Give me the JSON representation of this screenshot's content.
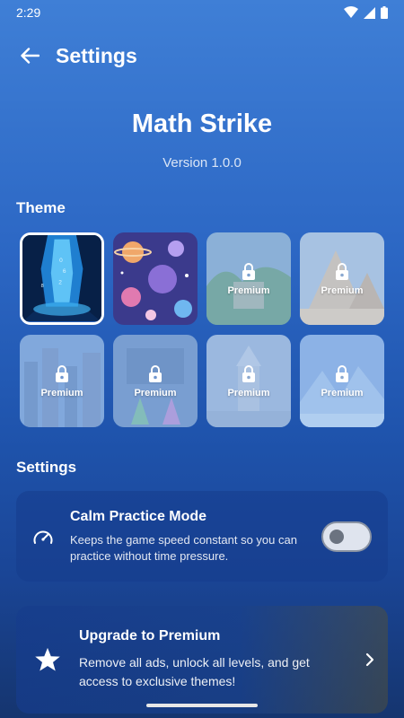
{
  "status_bar": {
    "time": "2:29"
  },
  "header": {
    "title": "Settings",
    "back_icon": "arrow-left-icon"
  },
  "app": {
    "name": "Math Strike",
    "version": "Version 1.0.0"
  },
  "theme_section": {
    "label": "Theme",
    "tiles": [
      {
        "name": "crystal-cave",
        "locked": false,
        "selected": true,
        "premium_label": ""
      },
      {
        "name": "space-planets",
        "locked": false,
        "selected": false,
        "premium_label": ""
      },
      {
        "name": "jungle-temple",
        "locked": true,
        "selected": false,
        "premium_label": "Premium"
      },
      {
        "name": "desert-pyramids",
        "locked": true,
        "selected": false,
        "premium_label": "Premium"
      },
      {
        "name": "city-skyline",
        "locked": true,
        "selected": false,
        "premium_label": "Premium"
      },
      {
        "name": "science-lab",
        "locked": true,
        "selected": false,
        "premium_label": "Premium"
      },
      {
        "name": "fantasy-castle",
        "locked": true,
        "selected": false,
        "premium_label": "Premium"
      },
      {
        "name": "ice-world",
        "locked": true,
        "selected": false,
        "premium_label": "Premium"
      }
    ]
  },
  "settings_section": {
    "label": "Settings",
    "calm_mode": {
      "title": "Calm Practice Mode",
      "description": "Keeps the game speed constant so you can practice without time pressure.",
      "enabled": false,
      "icon": "speedometer-icon"
    }
  },
  "upgrade": {
    "title": "Upgrade to Premium",
    "description": "Remove all ads, unlock all levels, and get access to exclusive themes!",
    "icon": "star-icon"
  }
}
